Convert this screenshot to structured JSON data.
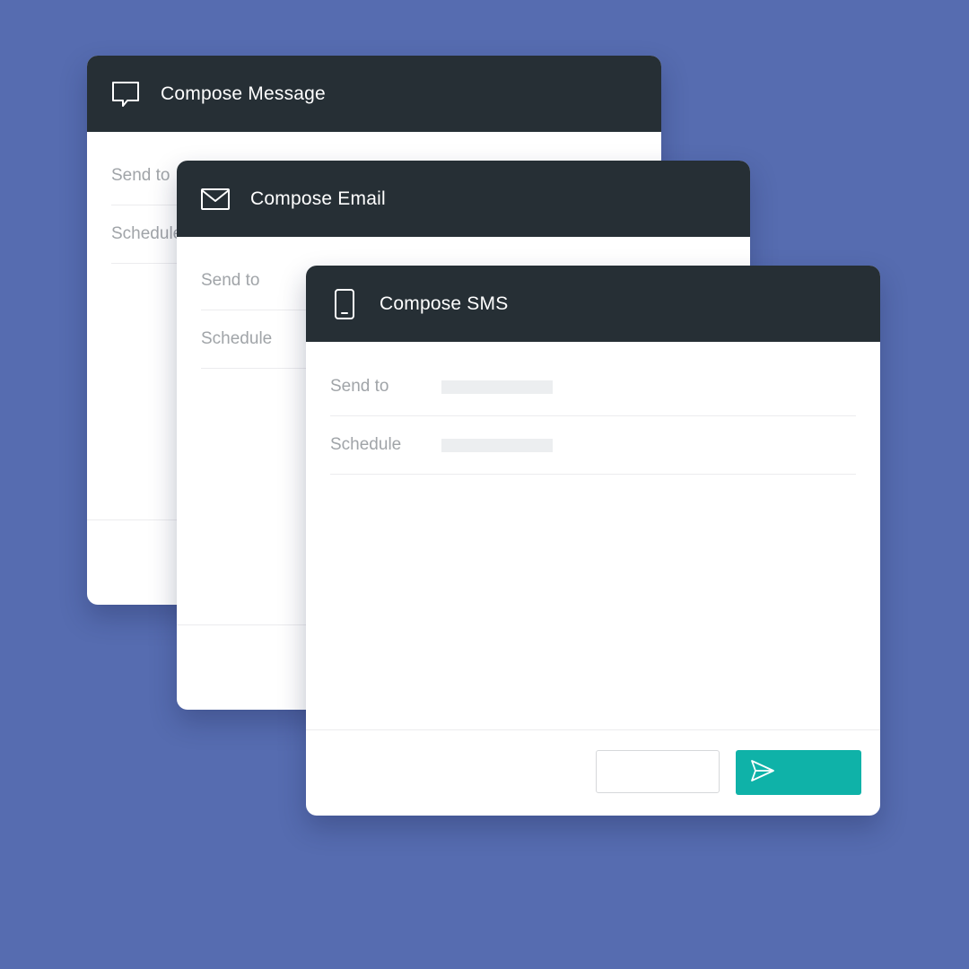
{
  "colors": {
    "background": "#566cb0",
    "header": "#262f35",
    "accent": "#0fb2a8"
  },
  "cards": [
    {
      "title": "Compose Message",
      "icon": "message-bubble-icon",
      "fields": [
        {
          "label": "Send to"
        },
        {
          "label": "Schedule"
        }
      ]
    },
    {
      "title": "Compose Email",
      "icon": "envelope-icon",
      "fields": [
        {
          "label": "Send to"
        },
        {
          "label": "Schedule"
        }
      ]
    },
    {
      "title": "Compose SMS",
      "icon": "mobile-phone-icon",
      "fields": [
        {
          "label": "Send to"
        },
        {
          "label": "Schedule"
        }
      ],
      "actions": {
        "secondary_icon": "none",
        "send_icon": "send-icon"
      }
    }
  ]
}
